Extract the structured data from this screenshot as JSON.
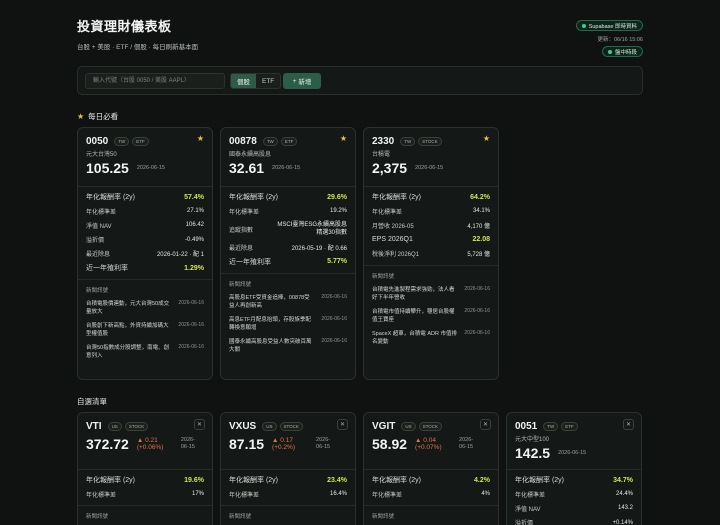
{
  "header": {
    "title": "投資理財儀表板",
    "subtitle": "台股 + 美股 · ETF / 個股 · 每日刷新基本面",
    "badge": "Supabase 即時資料",
    "updated": "更新：06/16 15:06",
    "status": "盤中時段"
  },
  "toolbar": {
    "search_placeholder": "輸入代號（台股 0050 / 美股 AAPL）",
    "seg_stock": "個股",
    "seg_etf": "ETF",
    "add_label": "新增"
  },
  "sections": {
    "must_watch": "每日必看",
    "watchlist": "自選清單"
  },
  "icons": {
    "star": "star-icon",
    "close": "close-icon",
    "plus": "plus-icon"
  },
  "colors": {
    "accent": "#2d5d48",
    "up_green": "#d4e34f",
    "down": "#e0734b",
    "star": "#e6c04a"
  },
  "must_cards": [
    {
      "symbol": "0050",
      "tags": [
        "TW",
        "ETF"
      ],
      "name": "元大台灣50",
      "price": "105.25",
      "date": "2026-06-15",
      "metrics": [
        {
          "label": "年化報酬率 (2y)",
          "value": "57.4%",
          "hl": true
        },
        {
          "label": "年化標準差",
          "value": "27.1%"
        },
        {
          "label": "淨值 NAV",
          "value": "106.42"
        },
        {
          "label": "溢折價",
          "value": "-0.49%"
        },
        {
          "label": "最近除息",
          "value": "2026-01-22 · 配 1"
        },
        {
          "label": "近一年殖利率",
          "value": "1.29%",
          "hl": true
        }
      ],
      "news_title": "新聞訊號",
      "news": [
        {
          "text": "台積電股價連動，元大台灣50成交量放大",
          "date": "2026-06-16"
        },
        {
          "text": "台股創下新高點，外資持續加碼大型權值股",
          "date": "2026-06-16"
        },
        {
          "text": "台灣50指數成分股調整，南電、創意列入",
          "date": "2026-06-16"
        }
      ]
    },
    {
      "symbol": "00878",
      "tags": [
        "TW",
        "ETF"
      ],
      "name": "國泰永續高股息",
      "price": "32.61",
      "date": "2026-06-15",
      "metrics": [
        {
          "label": "年化報酬率 (2y)",
          "value": "29.6%",
          "hl": true
        },
        {
          "label": "年化標準差",
          "value": "19.2%"
        },
        {
          "label": "追蹤指數",
          "value": "MSCI臺灣ESG永續高股息精選30指數",
          "wrap": true
        },
        {
          "label": "最近除息",
          "value": "2026-05-19 · 配 0.66"
        },
        {
          "label": "近一年殖利率",
          "value": "5.77%",
          "hl": true
        }
      ],
      "news_title": "新聞訊號",
      "news": [
        {
          "text": "高股息ETF受資金追捧，00878受益人再創新高",
          "date": "2026-06-16"
        },
        {
          "text": "高息ETF月配息抬頭，存股族季配轉換意願增",
          "date": "2026-06-16"
        },
        {
          "text": "國泰永續高股息受益人數突破百萬大關",
          "date": "2026-06-16"
        }
      ]
    },
    {
      "symbol": "2330",
      "tags": [
        "TW",
        "STOCK"
      ],
      "name": "台積電",
      "price": "2,375",
      "date": "2026-06-15",
      "metrics": [
        {
          "label": "年化報酬率 (2y)",
          "value": "64.2%",
          "hl": true
        },
        {
          "label": "年化標準差",
          "value": "34.1%"
        },
        {
          "label": "月營收 2026-05",
          "value": "4,170 億"
        },
        {
          "label": "EPS 2026Q1",
          "value": "22.08",
          "hl": true
        },
        {
          "label": "稅後淨利 2026Q1",
          "value": "5,728 億"
        }
      ],
      "news_title": "新聞訊號",
      "news": [
        {
          "text": "台積電先進製程需求強勁，法人看好下半年營收",
          "date": "2026-06-16"
        },
        {
          "text": "台積電市值持續攀升，穩居台股權值王寶座",
          "date": "2026-06-16"
        },
        {
          "text": "SpaceX 超車，台積電 ADR 市值排名變動",
          "date": "2026-06-16"
        }
      ]
    }
  ],
  "watch_cards": [
    {
      "symbol": "VTI",
      "tags": [
        "US",
        "STOCK"
      ],
      "name": "",
      "price": "372.72",
      "change": "▲ 0.21 (+0.06%)",
      "date": "2026-06-15",
      "metrics": [
        {
          "label": "年化報酬率 (2y)",
          "value": "19.6%",
          "hl": true
        },
        {
          "label": "年化標準差",
          "value": "17%"
        }
      ],
      "news_title": "新聞訊號"
    },
    {
      "symbol": "VXUS",
      "tags": [
        "US",
        "STOCK"
      ],
      "name": "",
      "price": "87.15",
      "change": "▲ 0.17 (+0.2%)",
      "date": "2026-06-15",
      "metrics": [
        {
          "label": "年化報酬率 (2y)",
          "value": "23.4%",
          "hl": true
        },
        {
          "label": "年化標準差",
          "value": "16.4%"
        }
      ],
      "news_title": "新聞訊號",
      "news_peek": {
        "text": "VXUS ETF Rises 0.4%",
        "date": "2026-06-17"
      }
    },
    {
      "symbol": "VGIT",
      "tags": [
        "US",
        "STOCK"
      ],
      "name": "",
      "price": "58.92",
      "change": "▲ 0.04 (+0.07%)",
      "date": "2026-06-15",
      "metrics": [
        {
          "label": "年化報酬率 (2y)",
          "value": "4.2%",
          "hl": true
        },
        {
          "label": "年化標準差",
          "value": "4%"
        }
      ],
      "news_title": "新聞訊號"
    },
    {
      "symbol": "0051",
      "tags": [
        "TW",
        "ETF"
      ],
      "name": "元大中型100",
      "price": "142.5",
      "change": "",
      "date": "2026-06-15",
      "metrics": [
        {
          "label": "年化報酬率 (2y)",
          "value": "34.7%",
          "hl": true
        },
        {
          "label": "年化標準差",
          "value": "24.4%"
        },
        {
          "label": "淨值 NAV",
          "value": "143.2"
        },
        {
          "label": "溢折價",
          "value": "+0.14%"
        }
      ]
    }
  ]
}
